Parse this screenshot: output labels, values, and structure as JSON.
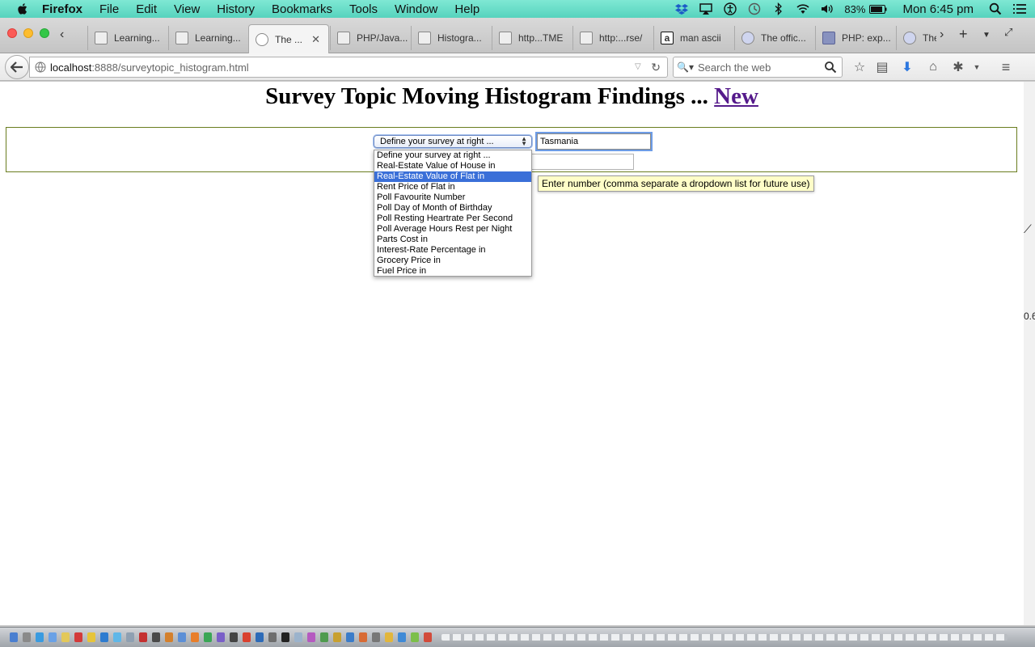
{
  "menubar": {
    "app": "Firefox",
    "menus": [
      "File",
      "Edit",
      "View",
      "History",
      "Bookmarks",
      "Tools",
      "Window",
      "Help"
    ],
    "battery": "83%",
    "clock": "Mon 6:45 pm"
  },
  "tabs": [
    {
      "title": "Learning...",
      "active": false
    },
    {
      "title": "Learning...",
      "active": false
    },
    {
      "title": "The ...",
      "active": true
    },
    {
      "title": "PHP/Java...",
      "active": false
    },
    {
      "title": "Histogra...",
      "active": false
    },
    {
      "title": "http...TME",
      "active": false
    },
    {
      "title": "http:...rse/",
      "active": false
    },
    {
      "title": "man ascii",
      "active": false
    },
    {
      "title": "The offic...",
      "active": false
    },
    {
      "title": "PHP: exp...",
      "active": false
    },
    {
      "title": "The",
      "active": false
    }
  ],
  "navbar": {
    "url_host": "localhost",
    "url_path": ":8888/surveytopic_histogram.html",
    "search_placeholder": "Search the web"
  },
  "page": {
    "title": "Survey Topic Moving Histogram Findings ... ",
    "title_link": "New",
    "select_value": "Define your survey at right ...",
    "location_value": "Tasmania",
    "tooltip": "Enter number (comma separate a dropdown list for future use)",
    "options": [
      {
        "label": "Define your survey at right ...",
        "selected": false
      },
      {
        "label": "Real-Estate Value of House in",
        "selected": false
      },
      {
        "label": "Real-Estate Value of Flat in",
        "selected": true
      },
      {
        "label": "Rent Price of Flat in",
        "selected": false
      },
      {
        "label": "Poll Favourite Number",
        "selected": false
      },
      {
        "label": "Poll Day of Month of Birthday",
        "selected": false
      },
      {
        "label": "Poll Resting Heartrate Per Second",
        "selected": false
      },
      {
        "label": "Poll Average Hours Rest per Night",
        "selected": false
      },
      {
        "label": "Parts Cost in",
        "selected": false
      },
      {
        "label": "Interest-Rate Percentage in",
        "selected": false
      },
      {
        "label": "Grocery Price in",
        "selected": false
      },
      {
        "label": "Fuel Price in",
        "selected": false
      }
    ],
    "right_edge_clip": "0.6"
  },
  "colors": {
    "menubar": "#56d3bd",
    "link_visited": "#551a8b",
    "selection": "#3a6fd8",
    "tooltip_bg": "#fffec8",
    "survey_border": "#6a7d1f"
  }
}
